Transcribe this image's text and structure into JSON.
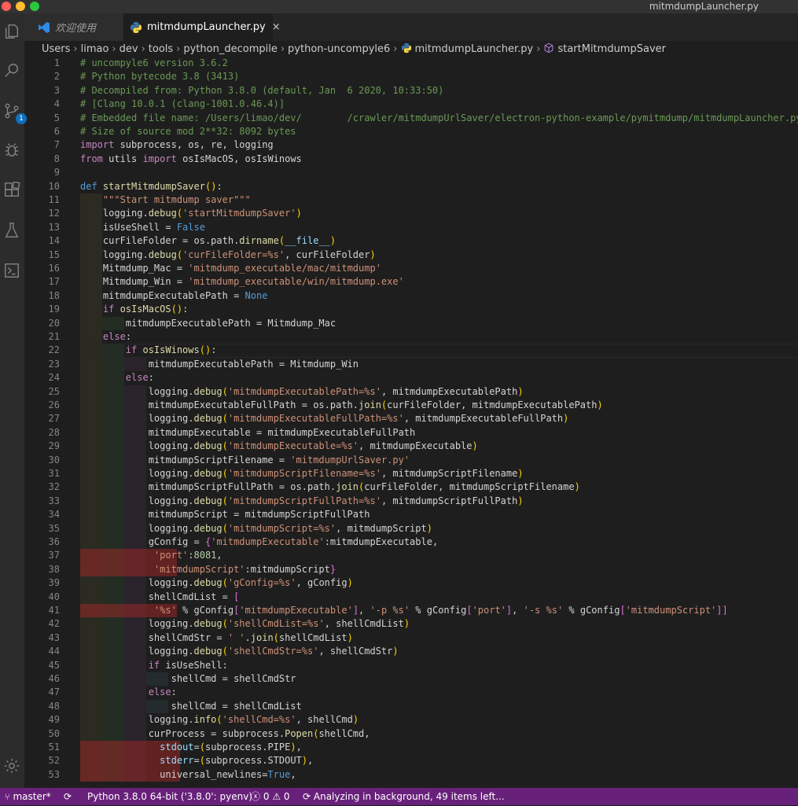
{
  "window": {
    "title": "mitmdumpLauncher.py"
  },
  "tabs": [
    {
      "label": "欢迎使用",
      "icon": "vscode-logo-icon"
    },
    {
      "label": "mitmdumpLauncher.py",
      "icon": "python-file-icon",
      "close": "×"
    }
  ],
  "breadcrumb": [
    "Users",
    "limao",
    "dev",
    "tools",
    "python_decompile",
    "python-uncompyle6",
    "mitmdumpLauncher.py",
    "startMitmdumpSaver"
  ],
  "source_control_badge": "1",
  "code_lines": [
    "# uncompyle6 version 3.6.2",
    "# Python bytecode 3.8 (3413)",
    "# Decompiled from: Python 3.8.0 (default, Jan  6 2020, 10:33:50)",
    "# [Clang 10.0.1 (clang-1001.0.46.4)]",
    "# Embedded file name: /Users/limao/dev/        /crawler/mitmdumpUrlSaver/electron-python-example/pymitmdump/mitmdumpLauncher.py",
    "# Size of source mod 2**32: 8092 bytes",
    "import subprocess, os, re, logging",
    "from utils import osIsMacOS, osIsWinows",
    "",
    "def startMitmdumpSaver():",
    "    \"\"\"Start mitmdump saver\"\"\"",
    "    logging.debug('startMitmdumpSaver')",
    "    isUseShell = False",
    "    curFileFolder = os.path.dirname(__file__)",
    "    logging.debug('curFileFolder=%s', curFileFolder)",
    "    Mitmdump_Mac = 'mitmdump_executable/mac/mitmdump'",
    "    Mitmdump_Win = 'mitmdump_executable/win/mitmdump.exe'",
    "    mitmdumpExecutablePath = None",
    "    if osIsMacOS():",
    "        mitmdumpExecutablePath = Mitmdump_Mac",
    "    else:",
    "        if osIsWinows():",
    "            mitmdumpExecutablePath = Mitmdump_Win",
    "        else:",
    "            logging.debug('mitmdumpExecutablePath=%s', mitmdumpExecutablePath)",
    "            mitmdumpExecutableFullPath = os.path.join(curFileFolder, mitmdumpExecutablePath)",
    "            logging.debug('mitmdumpExecutableFullPath=%s', mitmdumpExecutableFullPath)",
    "            mitmdumpExecutable = mitmdumpExecutableFullPath",
    "            logging.debug('mitmdumpExecutable=%s', mitmdumpExecutable)",
    "            mitmdumpScriptFilename = 'mitmdumpUrlSaver.py'",
    "            logging.debug('mitmdumpScriptFilename=%s', mitmdumpScriptFilename)",
    "            mitmdumpScriptFullPath = os.path.join(curFileFolder, mitmdumpScriptFilename)",
    "            logging.debug('mitmdumpScriptFullPath=%s', mitmdumpScriptFullPath)",
    "            mitmdumpScript = mitmdumpScriptFullPath",
    "            logging.debug('mitmdumpScript=%s', mitmdumpScript)",
    "            gConfig = {'mitmdumpExecutable':mitmdumpExecutable, ",
    "             'port':8081, ",
    "             'mitmdumpScript':mitmdumpScript}",
    "            logging.debug('gConfig=%s', gConfig)",
    "            shellCmdList = [",
    "             '%s' % gConfig['mitmdumpExecutable'], '-p %s' % gConfig['port'], '-s %s' % gConfig['mitmdumpScript']]",
    "            logging.debug('shellCmdList=%s', shellCmdList)",
    "            shellCmdStr = ' '.join(shellCmdList)",
    "            logging.debug('shellCmdStr=%s', shellCmdStr)",
    "            if isUseShell:",
    "                shellCmd = shellCmdStr",
    "            else:",
    "                shellCmd = shellCmdList",
    "            logging.info('shellCmd=%s', shellCmd)",
    "            curProcess = subprocess.Popen(shellCmd,",
    "              stdout=(subprocess.PIPE),",
    "              stderr=(subprocess.STDOUT),",
    "              universal_newlines=True,"
  ],
  "status": {
    "branch": "master*",
    "python": "Python 3.8.0 64-bit ('3.8.0': pyenv)",
    "errors": "0",
    "warnings": "0",
    "analysis": "Analyzing in background, 49 items left..."
  }
}
